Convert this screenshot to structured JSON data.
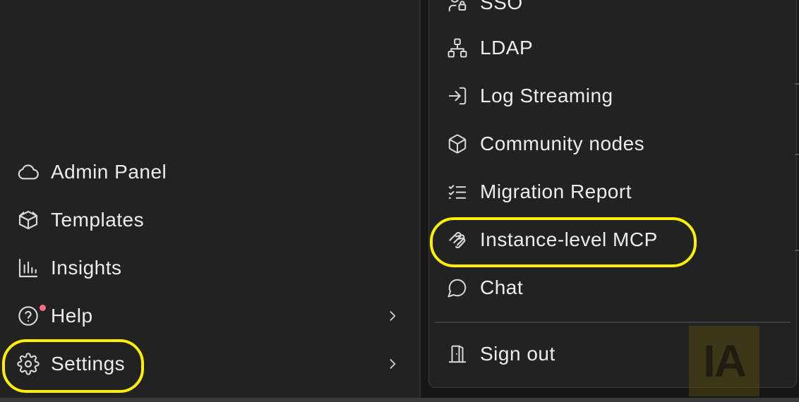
{
  "sidebar": {
    "items": [
      {
        "label": "Admin Panel",
        "icon": "cloud-icon"
      },
      {
        "label": "Templates",
        "icon": "box-icon"
      },
      {
        "label": "Insights",
        "icon": "bar-chart-icon"
      },
      {
        "label": "Help",
        "icon": "help-circle-icon",
        "has_submenu": true,
        "notification_dot": true
      },
      {
        "label": "Settings",
        "icon": "gear-icon",
        "has_submenu": true,
        "highlighted": true
      }
    ]
  },
  "settings_menu": {
    "items": [
      {
        "label": "SSO",
        "icon": "user-lock-icon"
      },
      {
        "label": "LDAP",
        "icon": "network-icon"
      },
      {
        "label": "Log Streaming",
        "icon": "log-in-icon"
      },
      {
        "label": "Community nodes",
        "icon": "package-icon"
      },
      {
        "label": "Migration Report",
        "icon": "checklist-icon"
      },
      {
        "label": "Instance-level MCP",
        "icon": "mcp-icon",
        "highlighted": true
      },
      {
        "label": "Chat",
        "icon": "chat-bubble-icon"
      }
    ],
    "sign_out": {
      "label": "Sign out",
      "icon": "door-icon"
    }
  },
  "watermark": {
    "text": "IA"
  },
  "colors": {
    "background": "#222222",
    "highlight": "#ffef00",
    "notification_dot": "#ff6f7d",
    "text": "#ececec"
  }
}
